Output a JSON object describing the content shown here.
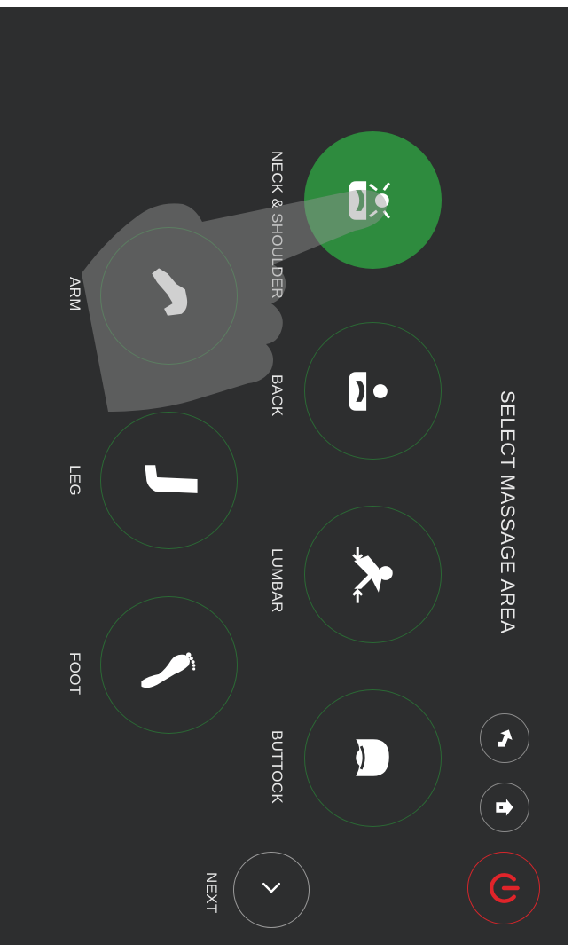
{
  "header": {
    "title": "SELECT MASSAGE AREA"
  },
  "areas": [
    {
      "id": "neck-shoulder",
      "label": "NECK & SHOULDER",
      "icon": "neck-shoulder-icon",
      "selected": true
    },
    {
      "id": "back",
      "label": "BACK",
      "icon": "back-icon",
      "selected": false
    },
    {
      "id": "lumbar",
      "label": "LUMBAR",
      "icon": "lumbar-icon",
      "selected": false
    },
    {
      "id": "buttock",
      "label": "BUTTOCK",
      "icon": "buttock-icon",
      "selected": false
    },
    {
      "id": "arm",
      "label": "ARM",
      "icon": "arm-icon",
      "selected": false
    },
    {
      "id": "leg",
      "label": "LEG",
      "icon": "leg-icon",
      "selected": false
    },
    {
      "id": "foot",
      "label": "FOOT",
      "icon": "foot-icon",
      "selected": false
    }
  ],
  "navigation": {
    "next_label": "NEXT",
    "next_icon": "chevron-down-icon"
  },
  "controls": [
    {
      "id": "recline-up",
      "icon": "recline-up-icon"
    },
    {
      "id": "recline-down",
      "icon": "recline-down-icon"
    },
    {
      "id": "power",
      "icon": "power-icon"
    }
  ],
  "colors": {
    "background": "#2d2e2f",
    "selected": "#2e8b3e",
    "circle_border": "#2b6a35",
    "power": "#e0242a",
    "text": "#e8e8e8"
  }
}
